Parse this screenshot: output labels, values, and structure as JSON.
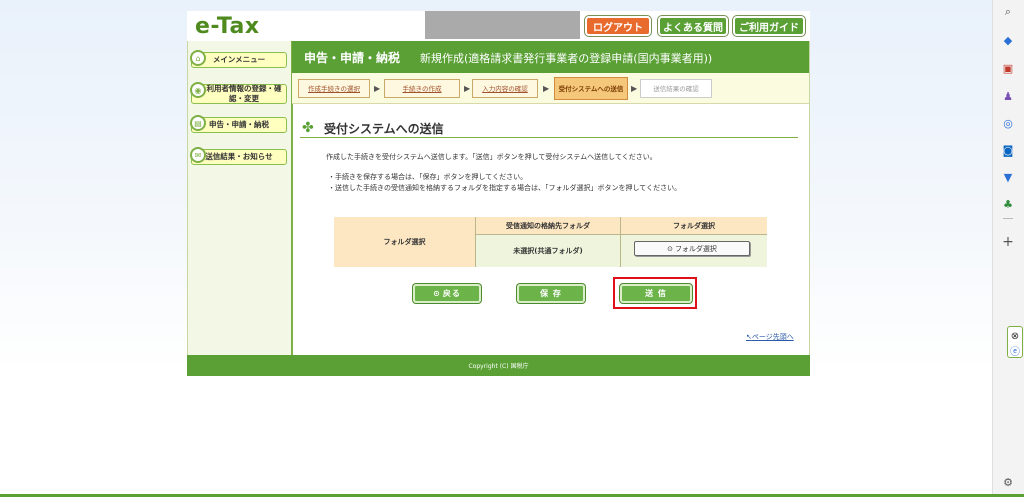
{
  "header_bar": {
    "logo": "e-Tax",
    "logout": "ログアウト",
    "faq": "よくある質問",
    "guide": "ご利用ガイド"
  },
  "sidebar": {
    "items": [
      {
        "label": "メインメニュー",
        "icon": "home-icon"
      },
      {
        "label": "利用者情報の登録・確認・変更",
        "icon": "person-icon"
      },
      {
        "label": "申告・申請・納税",
        "icon": "document-icon"
      },
      {
        "label": "送信結果・お知らせ",
        "icon": "mail-icon"
      }
    ]
  },
  "page_header": {
    "title": "申告・申請・納税",
    "subtitle": "新規作成(適格請求書発行事業者の登録申請(国内事業者用))"
  },
  "steps": [
    {
      "label": "作成手続きの選択",
      "state": "done"
    },
    {
      "label": "手続きの作成",
      "state": "done"
    },
    {
      "label": "入力内容の確認",
      "state": "done"
    },
    {
      "label": "受付システムへの送信",
      "state": "active"
    },
    {
      "label": "送信結果の確認",
      "state": "pending"
    }
  ],
  "section": {
    "title": "受付システムへの送信",
    "description": "作成した手続きを受付システムへ送信します。「送信」ボタンを押して受付システムへ送信してください。",
    "bullets": [
      "手続きを保存する場合は、「保存」ボタンを押してください。",
      "送信した手続きの受信通知を格納するフォルダを指定する場合は、「フォルダ選択」ボタンを押してください。"
    ]
  },
  "folder_table": {
    "row_header": "フォルダ選択",
    "col1_header": "受信通知の格納先フォルダ",
    "col2_header": "フォルダ選択",
    "col1_value": "未選択(共通フォルダ)",
    "folder_button": "フォルダ選択"
  },
  "actions": {
    "back": "戻る",
    "save": "保 存",
    "send": "送 信"
  },
  "page_top_link": "ページ先頭へ",
  "footer": "Copyright (C) 国税庁",
  "colors": {
    "brand_green": "#5aa035",
    "accent_orange": "#e86a2c",
    "highlight_red": "#e0101a"
  }
}
